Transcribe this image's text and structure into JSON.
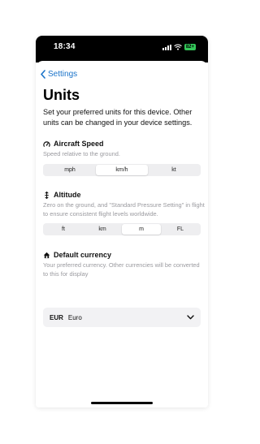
{
  "status_bar": {
    "time": "18:34",
    "battery": "82+"
  },
  "nav": {
    "back_label": "Settings"
  },
  "page": {
    "title": "Units",
    "description": "Set your preferred units for this device. Other units can be changed in your device settings."
  },
  "aircraft_speed": {
    "title": "Aircraft Speed",
    "icon": "speedometer-icon",
    "description": "Speed relative to the ground.",
    "options": [
      "mph",
      "km/h",
      "kt"
    ],
    "selected": "km/h"
  },
  "altitude": {
    "title": "Altitude",
    "icon": "altitude-icon",
    "description": "Zero on the ground, and \"Standard Pressure Setting\" in flight to ensure consistent flight levels worldwide.",
    "options": [
      "ft",
      "km",
      "m",
      "FL"
    ],
    "selected": "m"
  },
  "currency": {
    "title": "Default currency",
    "icon": "home-icon",
    "description": "Your preferred currency. Other currencies will be converted to this for display",
    "selected_code": "EUR",
    "selected_name": "Euro"
  },
  "colors": {
    "accent": "#1a73c9",
    "battery": "#34c759",
    "muted_text": "#9a9a9f"
  }
}
